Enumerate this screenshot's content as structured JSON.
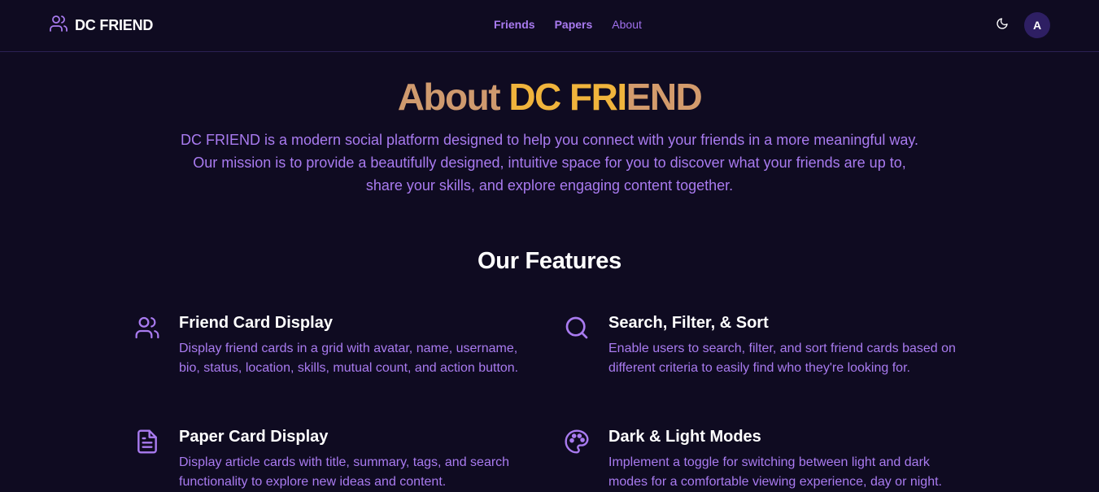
{
  "brand": {
    "name": "DC FRIEND",
    "icon": "users-icon"
  },
  "nav": {
    "items": [
      {
        "label": "Friends"
      },
      {
        "label": "Papers"
      },
      {
        "label": "About"
      }
    ]
  },
  "header": {
    "theme_icon": "moon-icon",
    "avatar_initial": "A"
  },
  "hero": {
    "title_part1": "About ",
    "title_part2": "DC FRI",
    "title_part3": "END",
    "description": "DC FRIEND is a modern social platform designed to help you connect with your friends in a more meaningful way. Our mission is to provide a beautifully designed, intuitive space for you to discover what your friends are up to, share your skills, and explore engaging content together."
  },
  "features": {
    "heading": "Our Features",
    "items": [
      {
        "icon": "users-icon",
        "title": "Friend Card Display",
        "description": "Display friend cards in a grid with avatar, name, username, bio, status, location, skills, mutual count, and action button."
      },
      {
        "icon": "search-icon",
        "title": "Search, Filter, & Sort",
        "description": "Enable users to search, filter, and sort friend cards based on different criteria to easily find who they're looking for."
      },
      {
        "icon": "document-icon",
        "title": "Paper Card Display",
        "description": "Display article cards with title, summary, tags, and search functionality to explore new ideas and content."
      },
      {
        "icon": "palette-icon",
        "title": "Dark & Light Modes",
        "description": "Implement a toggle for switching between light and dark modes for a comfortable viewing experience, day or night."
      }
    ]
  },
  "colors": {
    "background": "#0f0b21",
    "accent": "#a97bf0",
    "title_gold": "#f0b43c",
    "title_bronze": "#cf9a6e"
  }
}
